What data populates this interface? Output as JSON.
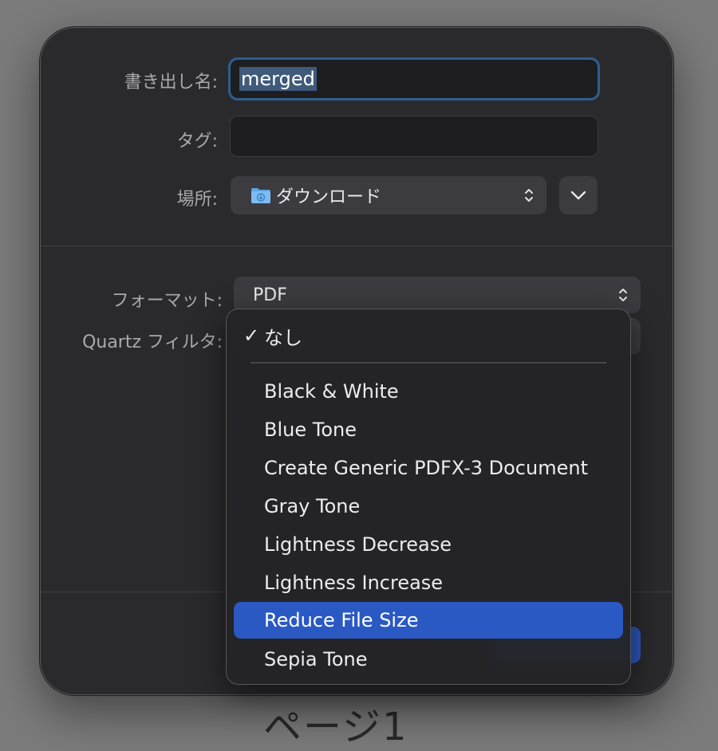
{
  "background_text": "ページ1",
  "dialog": {
    "export_name_label": "書き出し名:",
    "export_name_value": "merged",
    "tags_label": "タグ:",
    "tags_value": "",
    "location_label": "場所:",
    "location_value": "ダウンロード",
    "location_icon": "downloads-folder-icon",
    "format_label": "フォーマット:",
    "format_value": "PDF",
    "quartz_label": "Quartz フィルタ:"
  },
  "menu": {
    "items": [
      {
        "label": "なし",
        "checked": true
      },
      {
        "label": "Black & White"
      },
      {
        "label": "Blue Tone"
      },
      {
        "label": "Create Generic PDFX-3 Document"
      },
      {
        "label": "Gray Tone"
      },
      {
        "label": "Lightness Decrease"
      },
      {
        "label": "Lightness Increase"
      },
      {
        "label": "Reduce File Size",
        "highlighted": true
      },
      {
        "label": "Sepia Tone"
      }
    ],
    "check_glyph": "✓"
  },
  "colors": {
    "accent": "#2b59c3",
    "focus_ring": "#2e5f8e",
    "dialog_bg": "#2a2a2d"
  }
}
